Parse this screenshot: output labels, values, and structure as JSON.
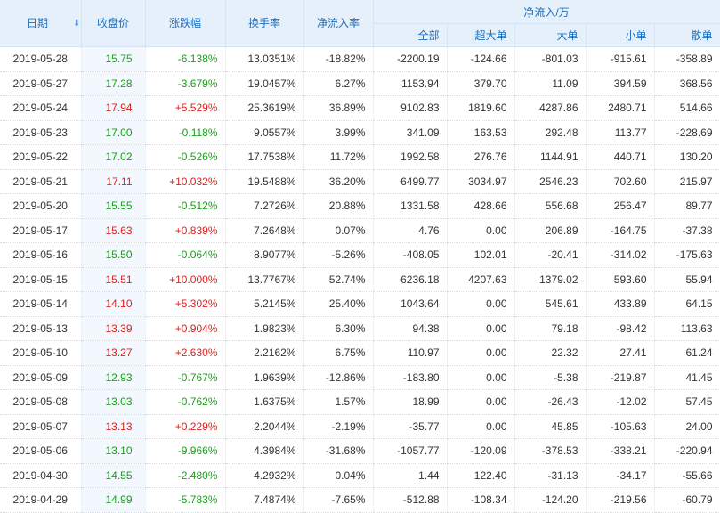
{
  "header": {
    "date": "日期",
    "close": "收盘价",
    "change": "涨跌幅",
    "turnover": "换手率",
    "net_inflow_rate": "净流入率",
    "net_flow_group": "净流入/万",
    "all": "全部",
    "super_large": "超大单",
    "large": "大单",
    "small": "小单",
    "retail": "散单"
  },
  "colors": {
    "up": "#e0211a",
    "down": "#1a9e1a",
    "header_bg": "#e6f0fb",
    "header_text": "#1a6fc1"
  },
  "rows": [
    {
      "date": "2019-05-28",
      "close": "15.75",
      "change": "-6.138%",
      "turnover": "13.0351%",
      "rate": "-18.82%",
      "all": "-2200.19",
      "super": "-124.66",
      "large": "-801.03",
      "small": "-915.61",
      "retail": "-358.89",
      "dir": "down"
    },
    {
      "date": "2019-05-27",
      "close": "17.28",
      "change": "-3.679%",
      "turnover": "19.0457%",
      "rate": "6.27%",
      "all": "1153.94",
      "super": "379.70",
      "large": "11.09",
      "small": "394.59",
      "retail": "368.56",
      "dir": "down"
    },
    {
      "date": "2019-05-24",
      "close": "17.94",
      "change": "+5.529%",
      "turnover": "25.3619%",
      "rate": "36.89%",
      "all": "9102.83",
      "super": "1819.60",
      "large": "4287.86",
      "small": "2480.71",
      "retail": "514.66",
      "dir": "up"
    },
    {
      "date": "2019-05-23",
      "close": "17.00",
      "change": "-0.118%",
      "turnover": "9.0557%",
      "rate": "3.99%",
      "all": "341.09",
      "super": "163.53",
      "large": "292.48",
      "small": "113.77",
      "retail": "-228.69",
      "dir": "down"
    },
    {
      "date": "2019-05-22",
      "close": "17.02",
      "change": "-0.526%",
      "turnover": "17.7538%",
      "rate": "11.72%",
      "all": "1992.58",
      "super": "276.76",
      "large": "1144.91",
      "small": "440.71",
      "retail": "130.20",
      "dir": "down"
    },
    {
      "date": "2019-05-21",
      "close": "17.11",
      "change": "+10.032%",
      "turnover": "19.5488%",
      "rate": "36.20%",
      "all": "6499.77",
      "super": "3034.97",
      "large": "2546.23",
      "small": "702.60",
      "retail": "215.97",
      "dir": "up"
    },
    {
      "date": "2019-05-20",
      "close": "15.55",
      "change": "-0.512%",
      "turnover": "7.2726%",
      "rate": "20.88%",
      "all": "1331.58",
      "super": "428.66",
      "large": "556.68",
      "small": "256.47",
      "retail": "89.77",
      "dir": "down"
    },
    {
      "date": "2019-05-17",
      "close": "15.63",
      "change": "+0.839%",
      "turnover": "7.2648%",
      "rate": "0.07%",
      "all": "4.76",
      "super": "0.00",
      "large": "206.89",
      "small": "-164.75",
      "retail": "-37.38",
      "dir": "up"
    },
    {
      "date": "2019-05-16",
      "close": "15.50",
      "change": "-0.064%",
      "turnover": "8.9077%",
      "rate": "-5.26%",
      "all": "-408.05",
      "super": "102.01",
      "large": "-20.41",
      "small": "-314.02",
      "retail": "-175.63",
      "dir": "down"
    },
    {
      "date": "2019-05-15",
      "close": "15.51",
      "change": "+10.000%",
      "turnover": "13.7767%",
      "rate": "52.74%",
      "all": "6236.18",
      "super": "4207.63",
      "large": "1379.02",
      "small": "593.60",
      "retail": "55.94",
      "dir": "up"
    },
    {
      "date": "2019-05-14",
      "close": "14.10",
      "change": "+5.302%",
      "turnover": "5.2145%",
      "rate": "25.40%",
      "all": "1043.64",
      "super": "0.00",
      "large": "545.61",
      "small": "433.89",
      "retail": "64.15",
      "dir": "up"
    },
    {
      "date": "2019-05-13",
      "close": "13.39",
      "change": "+0.904%",
      "turnover": "1.9823%",
      "rate": "6.30%",
      "all": "94.38",
      "super": "0.00",
      "large": "79.18",
      "small": "-98.42",
      "retail": "113.63",
      "dir": "up"
    },
    {
      "date": "2019-05-10",
      "close": "13.27",
      "change": "+2.630%",
      "turnover": "2.2162%",
      "rate": "6.75%",
      "all": "110.97",
      "super": "0.00",
      "large": "22.32",
      "small": "27.41",
      "retail": "61.24",
      "dir": "up"
    },
    {
      "date": "2019-05-09",
      "close": "12.93",
      "change": "-0.767%",
      "turnover": "1.9639%",
      "rate": "-12.86%",
      "all": "-183.80",
      "super": "0.00",
      "large": "-5.38",
      "small": "-219.87",
      "retail": "41.45",
      "dir": "down"
    },
    {
      "date": "2019-05-08",
      "close": "13.03",
      "change": "-0.762%",
      "turnover": "1.6375%",
      "rate": "1.57%",
      "all": "18.99",
      "super": "0.00",
      "large": "-26.43",
      "small": "-12.02",
      "retail": "57.45",
      "dir": "down"
    },
    {
      "date": "2019-05-07",
      "close": "13.13",
      "change": "+0.229%",
      "turnover": "2.2044%",
      "rate": "-2.19%",
      "all": "-35.77",
      "super": "0.00",
      "large": "45.85",
      "small": "-105.63",
      "retail": "24.00",
      "dir": "up"
    },
    {
      "date": "2019-05-06",
      "close": "13.10",
      "change": "-9.966%",
      "turnover": "4.3984%",
      "rate": "-31.68%",
      "all": "-1057.77",
      "super": "-120.09",
      "large": "-378.53",
      "small": "-338.21",
      "retail": "-220.94",
      "dir": "down"
    },
    {
      "date": "2019-04-30",
      "close": "14.55",
      "change": "-2.480%",
      "turnover": "4.2932%",
      "rate": "0.04%",
      "all": "1.44",
      "super": "122.40",
      "large": "-31.13",
      "small": "-34.17",
      "retail": "-55.66",
      "dir": "down"
    },
    {
      "date": "2019-04-29",
      "close": "14.99",
      "change": "-5.783%",
      "turnover": "7.4874%",
      "rate": "-7.65%",
      "all": "-512.88",
      "super": "-108.34",
      "large": "-124.20",
      "small": "-219.56",
      "retail": "-60.79",
      "dir": "down"
    }
  ]
}
